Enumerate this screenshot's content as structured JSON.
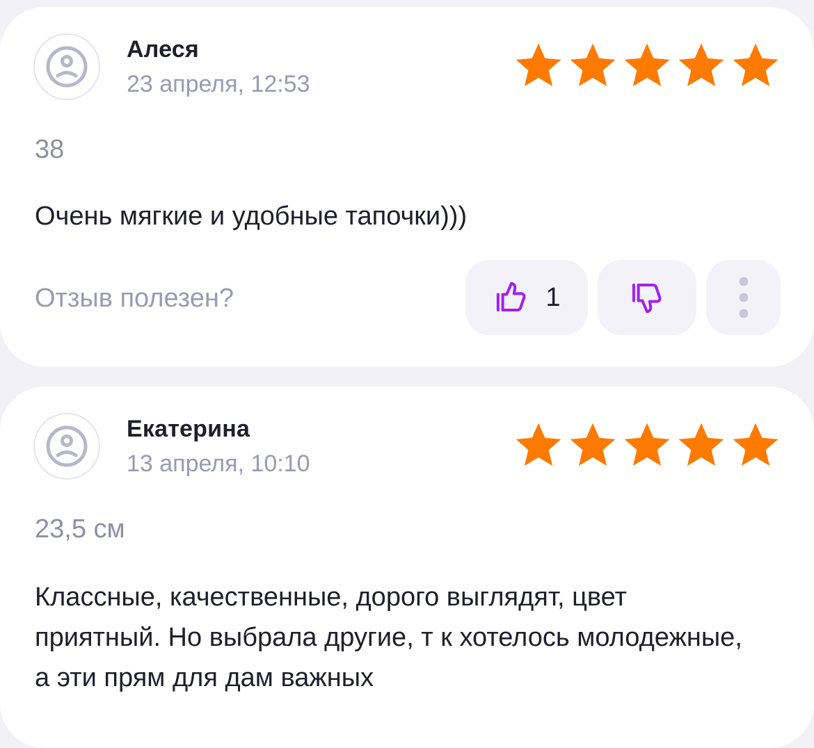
{
  "reviews": [
    {
      "author": "Алеся",
      "date": "23 апреля, 12:53",
      "rating": 5,
      "size": "38",
      "text": "Очень мягкие и удобные тапочки)))",
      "helpful_question": "Отзыв полезен?",
      "likes": "1"
    },
    {
      "author": "Екатерина",
      "date": "13 апреля, 10:10",
      "rating": 5,
      "size": "23,5 см",
      "text": "Классные, качественные, дорого выглядят, цвет приятный. Но выбрала другие, т к хотелось молодежные, а эти прям для дам важных"
    }
  ],
  "icons": {
    "avatar": "user-placeholder-icon",
    "star": "star-icon",
    "like": "thumbs-up-icon",
    "dislike": "thumbs-down-icon",
    "more": "more-vertical-icon"
  },
  "colors": {
    "star": "#ff7a00",
    "accent": "#a020f0",
    "background": "#f1f1f6",
    "muted_text": "#9a9ab2"
  }
}
